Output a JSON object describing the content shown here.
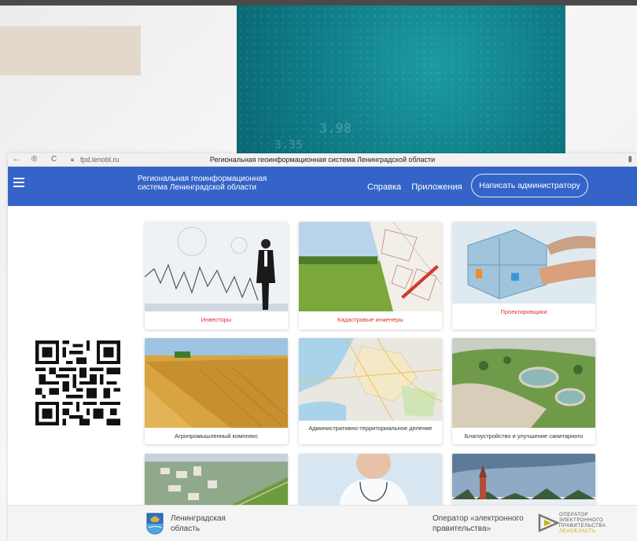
{
  "teal_numbers": [
    "3.98",
    "3.35"
  ],
  "browser": {
    "back": "←",
    "forward": "→",
    "reload": "C",
    "url": "fpd.lenobl.ru",
    "title": "Региональная геоинформационная система Ленинградской области",
    "bookmark": "▮"
  },
  "appbar": {
    "system_name": "Региональная геоинформационная система Ленинградской области",
    "links": [
      "Справка",
      "Приложения"
    ],
    "admin_button": "Написать администратору",
    "color": "#3464c8"
  },
  "cards": [
    {
      "label": "Инвесторы",
      "label_color": "#e0322c",
      "image": "investor-chart-image"
    },
    {
      "label": "Кадастровые инженеры",
      "label_color": "#e0322c",
      "image": "cadastral-map-field-image"
    },
    {
      "label": "Проектировщики",
      "label_color": "#e0322c",
      "image": "building-blueprint-image"
    },
    {
      "label": "Агропромышленный комплекс",
      "label_color": "#333333",
      "image": "wheat-field-harvester-image"
    },
    {
      "label": "Административно-территориальное деление",
      "label_color": "#333333",
      "image": "city-map-image"
    },
    {
      "label": "Благоустройство и улучшение санитарного",
      "label_color": "#333333",
      "image": "park-landscape-image"
    },
    {
      "label": "",
      "image": "aerial-district-image"
    },
    {
      "label": "",
      "image": "doctor-image"
    },
    {
      "label": "",
      "image": "church-winter-image"
    }
  ],
  "footer": {
    "region_name": "Ленинградская область",
    "operator_text": "Оператор «электронного правительства»",
    "operator_logo_lines": [
      "ОПЕРАТОР",
      "ЭЛЕКТРОННОГО",
      "ПРАВИТЕЛЬСТВА",
      "ЛЕНОБЛАСТЬ"
    ]
  }
}
